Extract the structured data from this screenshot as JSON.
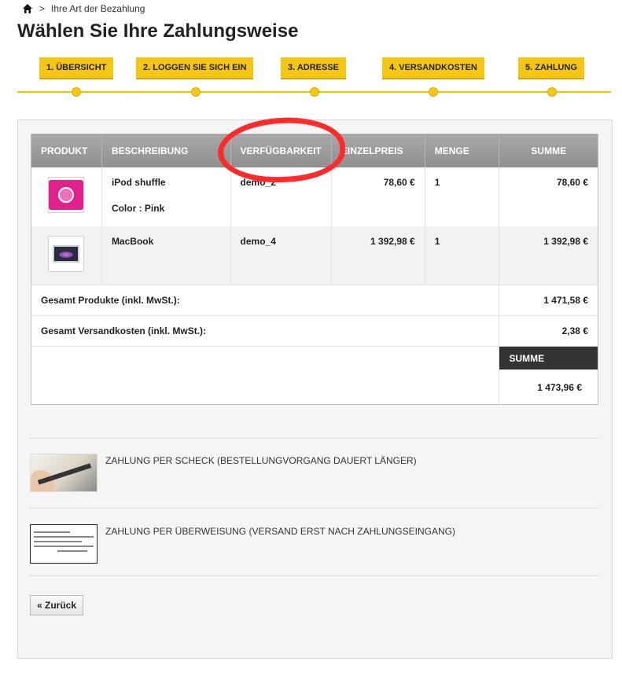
{
  "breadcrumb": {
    "separator": ">",
    "current": "Ihre Art der Bezahlung"
  },
  "page_title": "Wählen Sie Ihre Zahlungsweise",
  "steps": [
    "1. ÜBERSICHT",
    "2. LOGGEN SIE SICH EIN",
    "3. ADRESSE",
    "4. VERSANDKOSTEN",
    "5. ZAHLUNG"
  ],
  "table": {
    "headers": [
      "PRODUKT",
      "BESCHREIBUNG",
      "VERFÜGBARKEIT",
      "EINZELPREIS",
      "MENGE",
      "SUMME"
    ],
    "rows": [
      {
        "name": "iPod shuffle",
        "attr": "Color : Pink",
        "availability": "demo_2",
        "unit_price": "78,60 €",
        "qty": "1",
        "total": "78,60 €"
      },
      {
        "name": "MacBook",
        "attr": "",
        "availability": "demo_4",
        "unit_price": "1 392,98 €",
        "qty": "1",
        "total": "1 392,98 €"
      }
    ],
    "total_products_label": "Gesamt Produkte (inkl. MwSt.):",
    "total_products_value": "1 471,58 €",
    "total_shipping_label": "Gesamt Versandkosten (inkl. MwSt.):",
    "total_shipping_value": "2,38 €",
    "sum_label": "SUMME",
    "sum_value": "1 473,96 €"
  },
  "payment_options": [
    {
      "label": "ZAHLUNG PER SCHECK (BESTELLUNGVORGANG DAUERT LÄNGER)",
      "icon": "check-icon"
    },
    {
      "label": "ZAHLUNG PER ÜBERWEISUNG (VERSAND ERST NACH ZAHLUNGSEINGANG)",
      "icon": "bank-transfer-icon"
    }
  ],
  "back_button": "« Zurück",
  "colors": {
    "accent": "#f5c712",
    "annotation": "#ff2b2b"
  }
}
